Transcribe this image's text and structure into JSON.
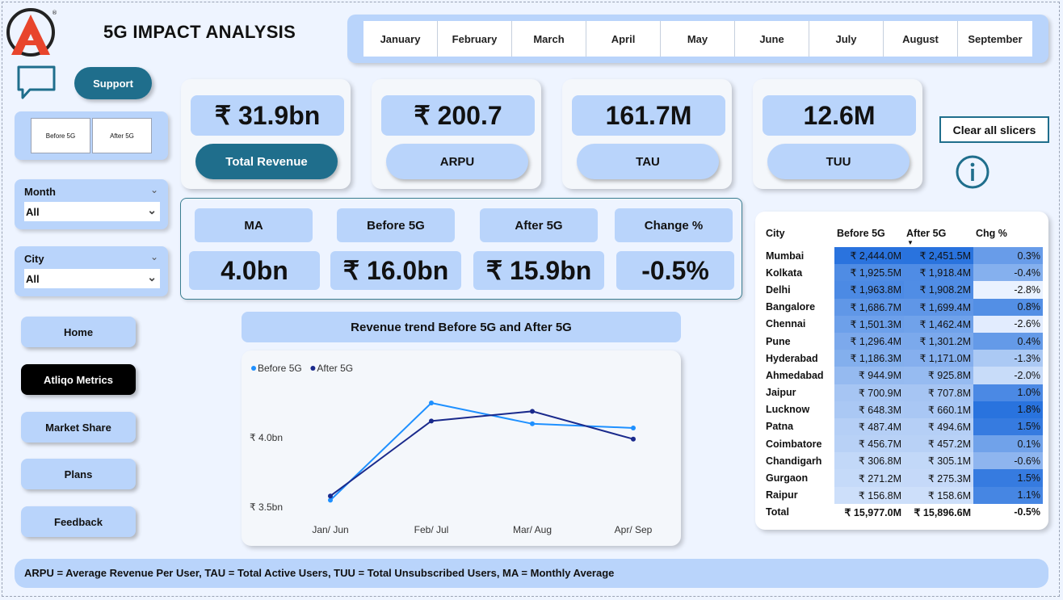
{
  "header": {
    "title": "5G IMPACT ANALYSIS",
    "months": [
      "January",
      "February",
      "March",
      "April",
      "May",
      "June",
      "July",
      "August",
      "September"
    ]
  },
  "sidebar": {
    "support_label": "Support",
    "toggle": {
      "before": "Before 5G",
      "after": "After 5G"
    },
    "month_slicer": {
      "label": "Month",
      "value": "All"
    },
    "city_slicer": {
      "label": "City",
      "value": "All"
    },
    "nav": [
      "Home",
      "Atliqo Metrics",
      "Market Share",
      "Plans",
      "Feedback"
    ],
    "active_nav": "Atliqo Metrics"
  },
  "kpis": [
    {
      "value": "₹ 31.9bn",
      "label": "Total Revenue"
    },
    {
      "value": "₹ 200.7",
      "label": "ARPU"
    },
    {
      "value": "161.7M",
      "label": "TAU"
    },
    {
      "value": "12.6M",
      "label": "TUU"
    }
  ],
  "clear_label": "Clear all slicers",
  "metrics": {
    "headers": [
      "MA",
      "Before 5G",
      "After 5G",
      "Change %"
    ],
    "values": [
      "4.0bn",
      "₹ 16.0bn",
      "₹ 15.9bn",
      "-0.5%"
    ]
  },
  "chart_title": "Revenue trend Before 5G and After 5G",
  "chart_data": {
    "type": "line",
    "categories": [
      "Jan/ Jun",
      "Feb/ Jul",
      "Mar/ Aug",
      "Apr/ Sep"
    ],
    "series": [
      {
        "name": "Before 5G",
        "color": "#1e90ff",
        "values": [
          3.55,
          4.25,
          4.1,
          4.07
        ]
      },
      {
        "name": "After 5G",
        "color": "#1a2a8c",
        "values": [
          3.58,
          4.12,
          4.19,
          3.99
        ]
      }
    ],
    "yticks": [
      {
        "value": 4.0,
        "label": "₹ 4.0bn"
      },
      {
        "value": 3.5,
        "label": "₹ 3.5bn"
      }
    ],
    "ylim": [
      3.5,
      4.0
    ],
    "legend": "top-left"
  },
  "table": {
    "headers": {
      "city": "City",
      "before": "Before 5G",
      "after": "After 5G",
      "change": "Chg %"
    },
    "rows": [
      {
        "city": "Mumbai",
        "before": "₹ 2,444.0M",
        "after": "₹ 2,451.5M",
        "change": "0.3%"
      },
      {
        "city": "Kolkata",
        "before": "₹ 1,925.5M",
        "after": "₹ 1,918.4M",
        "change": "-0.4%"
      },
      {
        "city": "Delhi",
        "before": "₹ 1,963.8M",
        "after": "₹ 1,908.2M",
        "change": "-2.8%"
      },
      {
        "city": "Bangalore",
        "before": "₹ 1,686.7M",
        "after": "₹ 1,699.4M",
        "change": "0.8%"
      },
      {
        "city": "Chennai",
        "before": "₹ 1,501.3M",
        "after": "₹ 1,462.4M",
        "change": "-2.6%"
      },
      {
        "city": "Pune",
        "before": "₹ 1,296.4M",
        "after": "₹ 1,301.2M",
        "change": "0.4%"
      },
      {
        "city": "Hyderabad",
        "before": "₹ 1,186.3M",
        "after": "₹ 1,171.0M",
        "change": "-1.3%"
      },
      {
        "city": "Ahmedabad",
        "before": "₹ 944.9M",
        "after": "₹ 925.8M",
        "change": "-2.0%"
      },
      {
        "city": "Jaipur",
        "before": "₹ 700.9M",
        "after": "₹ 707.8M",
        "change": "1.0%"
      },
      {
        "city": "Lucknow",
        "before": "₹ 648.3M",
        "after": "₹ 660.1M",
        "change": "1.8%"
      },
      {
        "city": "Patna",
        "before": "₹ 487.4M",
        "after": "₹ 494.6M",
        "change": "1.5%"
      },
      {
        "city": "Coimbatore",
        "before": "₹ 456.7M",
        "after": "₹ 457.2M",
        "change": "0.1%"
      },
      {
        "city": "Chandigarh",
        "before": "₹ 306.8M",
        "after": "₹ 305.1M",
        "change": "-0.6%"
      },
      {
        "city": "Gurgaon",
        "before": "₹ 271.2M",
        "after": "₹ 275.3M",
        "change": "1.5%"
      },
      {
        "city": "Raipur",
        "before": "₹ 156.8M",
        "after": "₹ 158.6M",
        "change": "1.1%"
      }
    ],
    "total": {
      "city": "Total",
      "before": "₹ 15,977.0M",
      "after": "₹ 15,896.6M",
      "change": "-0.5%"
    }
  },
  "footer": "ARPU = Average Revenue Per User, TAU = Total Active Users, TUU = Total Unsubscribed Users, MA = Monthly Average"
}
